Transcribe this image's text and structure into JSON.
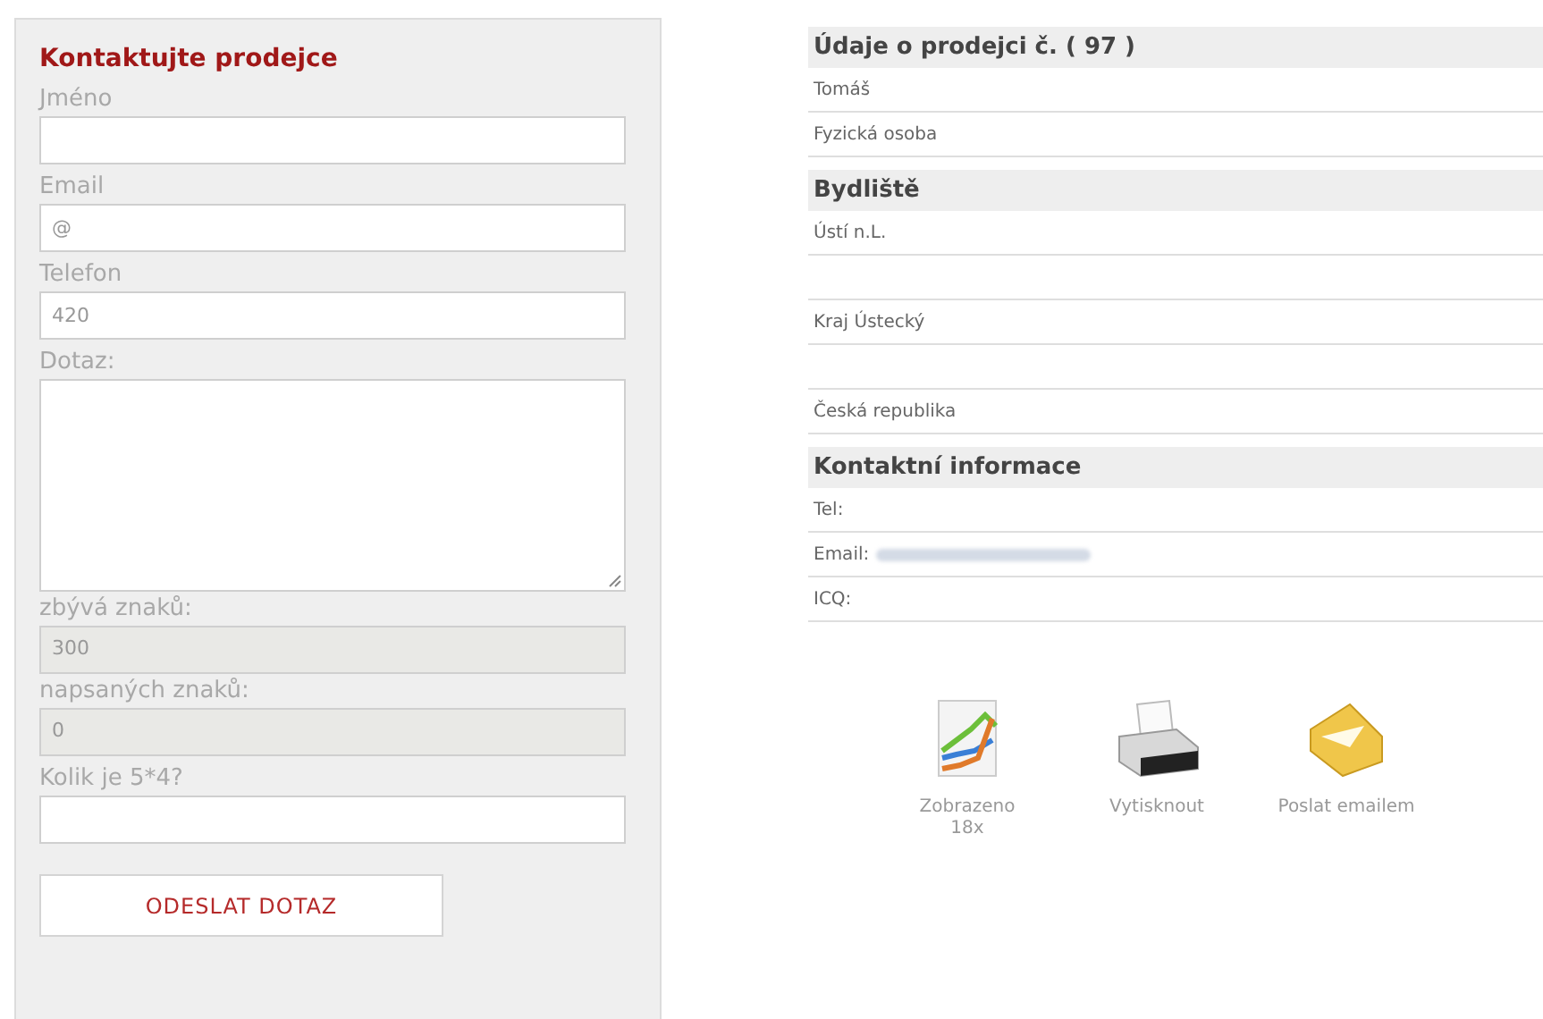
{
  "contact_form": {
    "title": "Kontaktujte prodejce",
    "fields": [
      {
        "kind": "input",
        "label": "Jméno"
      },
      {
        "kind": "input",
        "label": "Email",
        "value": "@"
      },
      {
        "kind": "input",
        "label": "Telefon",
        "value": "420"
      },
      {
        "kind": "textarea",
        "label": "Dotaz:"
      },
      {
        "kind": "readonly",
        "label": "zbývá znaků:",
        "value": "300"
      },
      {
        "kind": "readonly",
        "label": "napsaných znaků:",
        "value": "0"
      },
      {
        "kind": "input",
        "label": "Kolik je 5*4?"
      }
    ],
    "submit": "ODESLAT DOTAZ"
  },
  "seller_info": {
    "sections": [
      {
        "heading": "Údaje o prodejci č. ( 97 )",
        "rows": [
          {
            "kind": "text",
            "text": "Tomáš"
          },
          {
            "kind": "text",
            "text": "Fyzická osoba"
          }
        ]
      },
      {
        "heading": "Bydliště",
        "rows": [
          {
            "kind": "text",
            "text": "Ústí n.L."
          },
          {
            "kind": "empty"
          },
          {
            "kind": "text",
            "text": "Kraj Ústecký"
          },
          {
            "kind": "empty"
          },
          {
            "kind": "text",
            "text": "Česká republika"
          }
        ]
      },
      {
        "heading": "Kontaktní informace",
        "rows": [
          {
            "kind": "text",
            "text": "Tel:"
          },
          {
            "kind": "text",
            "text": "Email:",
            "redacted": true
          },
          {
            "kind": "text",
            "text": "ICQ:"
          }
        ]
      }
    ]
  },
  "actions": [
    {
      "kind": "chart",
      "label": "Zobrazeno",
      "sublabel": "18x"
    },
    {
      "kind": "printer",
      "label": "Vytisknout"
    },
    {
      "kind": "envelope",
      "label": "Poslat emailem"
    }
  ]
}
